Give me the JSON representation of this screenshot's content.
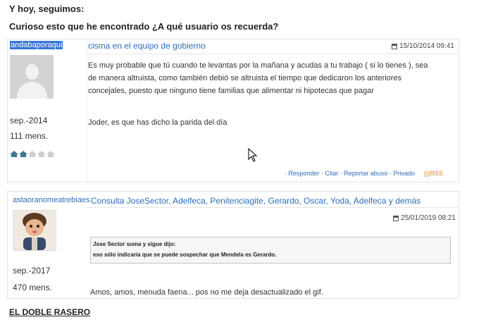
{
  "intro": "Y hoy, seguimos:",
  "question": "Curioso esto que he encontrado ¿A qué usuario os recuerda?",
  "post1": {
    "username": "andabaporaqui",
    "avatar_icon": "user-silhouette-icon",
    "joined": "sep.-2014",
    "messages": "111 mens.",
    "rank_icons": [
      true,
      true,
      false,
      false,
      false
    ],
    "title": "cisma en el equipo de gobierno",
    "date": "15/10/2014 09:41",
    "body_lines": [
      "Es muy probable que tú cuando te levantas por la mañana y acudas a tu trabajo ( si lo tienes ), sea",
      "de manera altruista, como también debió se altruista el tiempo que dedicaron los anteriores",
      "concejales, puesto que ninguno tiene familias que alimentar ni hipotecas que pagar"
    ],
    "reply": "Joder, es que has dicho la parida del día",
    "actions": {
      "responder": "· Responder",
      "citar": "· Citar",
      "reportar": "· Reportar abuso",
      "privado": "· Privado",
      "rss": "RSS"
    }
  },
  "post2": {
    "username": "astaoranomeatrebiaes",
    "avatar_icon": "doll-avatar-icon",
    "joined": "sep.-2017",
    "messages": "470 mens.",
    "title": "Consulta JoseSector, Adelfeca, Penitenciagite, Gerardo, Oscar, Yoda, Adelfeca y demás",
    "date": "25/01/2019 08:21",
    "quote_author": "Jose Sector suma y sigue dijo:",
    "quote_text": "eso sólo indicaría que se puede sospechar que Mendela es Gerardo.",
    "body": "Amos, amos, menuda faena... pos no me deja desactualizado el gif."
  },
  "section_title": "EL DOBLE RASERO",
  "colors": {
    "link": "#2a6ebb",
    "selection": "#3875d7",
    "rss": "#e8811f"
  }
}
